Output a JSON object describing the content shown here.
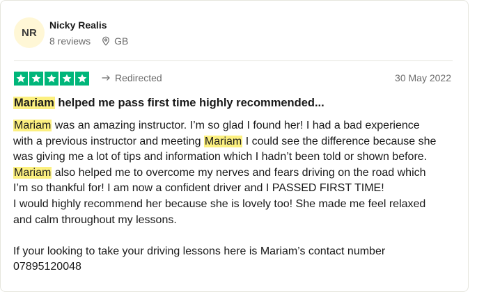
{
  "reviewer": {
    "initials": "NR",
    "name": "Nicky Realis",
    "reviews_count": "8 reviews",
    "country": "GB"
  },
  "rating": {
    "stars": 5,
    "max": 5,
    "color": "#00b67a"
  },
  "verification_label": "Redirected",
  "date": "30 May 2022",
  "highlight_color": "#fcf080",
  "title": {
    "highlight": "Mariam",
    "rest": " helped me pass first time highly recommended..."
  },
  "body_lines": {
    "l1_hl": "Mariam",
    "l1": " was an amazing instructor. I’m so glad I found her! I had a bad experience",
    "l2a": "with a previous instructor and meeting ",
    "l2_hl": "Mariam",
    "l2b": " I could see the difference because she",
    "l3": "was giving me a lot of tips and information which I hadn’t been told or shown before.",
    "l4_hl": "Mariam",
    "l4": " also helped me to overcome my nerves and fears driving on the road which",
    "l5": "I’m so thankful for! I am now a confident driver and I PASSED FIRST TIME!",
    "l6": "I would highly recommend her because she is lovely too! She made me feel relaxed",
    "l7": "and calm throughout my lessons.",
    "l9": "If your looking to take your driving lessons here is Mariam’s contact number",
    "l10": "07895120048"
  }
}
